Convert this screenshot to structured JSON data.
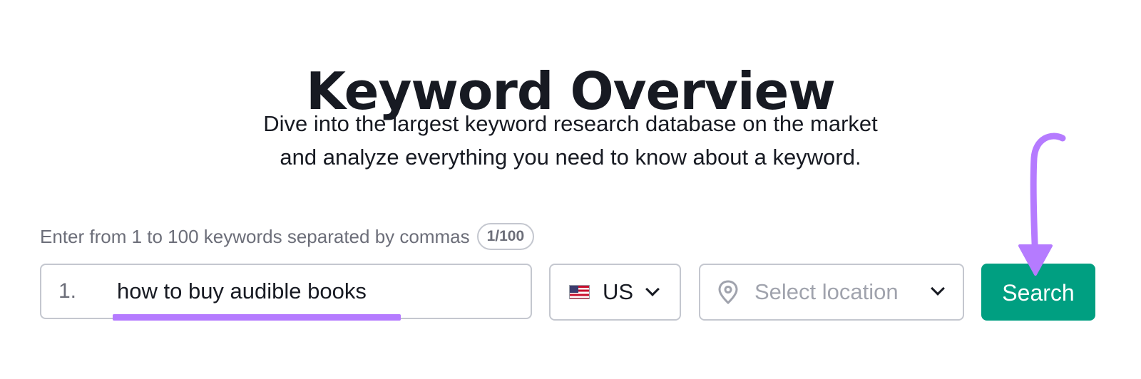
{
  "header": {
    "title": "Keyword Overview",
    "subtitle_line1": "Dive into the largest keyword research database on the market",
    "subtitle_line2": "and analyze everything you need to know about a keyword."
  },
  "form": {
    "hint": "Enter from 1 to 100 keywords separated by commas",
    "counter": "1/100",
    "keyword_index": "1.",
    "keyword_value": "how to buy audible books",
    "database": {
      "flag_icon": "us-flag-icon",
      "selected": "US"
    },
    "location": {
      "icon": "map-pin-icon",
      "placeholder": "Select location"
    },
    "search_label": "Search"
  },
  "colors": {
    "accent_green": "#009f81",
    "annotation_purple": "#b57bff",
    "text_dark": "#171a22",
    "text_muted": "#6c6e79",
    "border": "#c4c7cf"
  }
}
